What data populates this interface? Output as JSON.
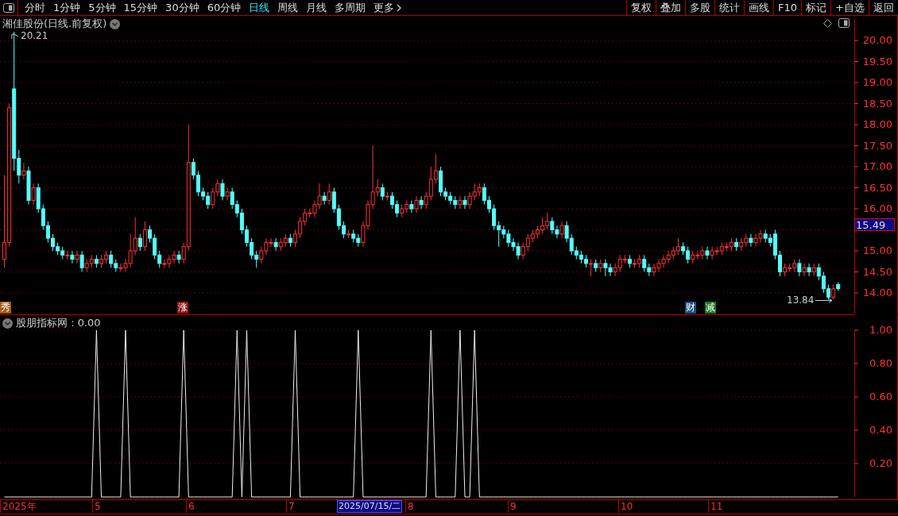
{
  "toolbar": {
    "periods": [
      {
        "label": "分时",
        "selected": false
      },
      {
        "label": "1分钟",
        "selected": false
      },
      {
        "label": "5分钟",
        "selected": false
      },
      {
        "label": "15分钟",
        "selected": false
      },
      {
        "label": "30分钟",
        "selected": false
      },
      {
        "label": "60分钟",
        "selected": false
      },
      {
        "label": "日线",
        "selected": true
      },
      {
        "label": "周线",
        "selected": false
      },
      {
        "label": "月线",
        "selected": false
      },
      {
        "label": "多周期",
        "selected": false
      },
      {
        "label": "更多",
        "selected": false
      }
    ],
    "actions": [
      "复权",
      "叠加",
      "多股",
      "统计",
      "画线",
      "F10",
      "标记",
      "+自选",
      "返回"
    ]
  },
  "price_panel": {
    "title": "湘佳股份(日线.前复权)",
    "high_label": "20.21",
    "low_label": "13.84",
    "current_price": "15.49",
    "chart_data": {
      "type": "candlestick",
      "ylim": [
        13.5,
        20.5
      ],
      "grid": true,
      "yticks": [
        {
          "value": 20,
          "label": "20.00"
        },
        {
          "value": 19.5,
          "label": "19.50"
        },
        {
          "value": 19,
          "label": "19.00"
        },
        {
          "value": 18.5,
          "label": "18.50"
        },
        {
          "value": 18,
          "label": "18.00"
        },
        {
          "value": 17.5,
          "label": "17.50"
        },
        {
          "value": 17,
          "label": "17.00"
        },
        {
          "value": 16.5,
          "label": "16.50"
        },
        {
          "value": 16,
          "label": "16.00"
        },
        {
          "value": 15,
          "label": "15.00"
        },
        {
          "value": 14.5,
          "label": "14.50"
        },
        {
          "value": 14,
          "label": "14.00"
        }
      ],
      "ohlc": [
        [
          14.8,
          16.8,
          14.6,
          15.2
        ],
        [
          15.2,
          18.5,
          15.1,
          18.4
        ],
        [
          18.85,
          20.21,
          16.9,
          17.2
        ],
        [
          17.2,
          17.4,
          16.6,
          16.8
        ],
        [
          16.8,
          17.1,
          16.7,
          16.9
        ],
        [
          16.9,
          17.0,
          16.1,
          16.2
        ],
        [
          16.2,
          16.6,
          16.1,
          16.5
        ],
        [
          16.5,
          16.6,
          15.9,
          16.0
        ],
        [
          16.0,
          16.1,
          15.5,
          15.6
        ],
        [
          15.6,
          15.7,
          15.2,
          15.3
        ],
        [
          15.3,
          15.4,
          15.0,
          15.1
        ],
        [
          15.1,
          15.2,
          14.9,
          15.0
        ],
        [
          15.0,
          15.1,
          14.8,
          14.9
        ],
        [
          14.9,
          15.0,
          14.8,
          14.9
        ],
        [
          14.9,
          15.0,
          14.7,
          14.8
        ],
        [
          14.8,
          15.0,
          14.7,
          14.9
        ],
        [
          14.9,
          15.0,
          14.5,
          14.6
        ],
        [
          14.6,
          14.8,
          14.5,
          14.7
        ],
        [
          14.7,
          14.9,
          14.6,
          14.8
        ],
        [
          14.8,
          14.9,
          14.6,
          14.7
        ],
        [
          14.7,
          14.9,
          14.6,
          14.8
        ],
        [
          14.8,
          15.0,
          14.7,
          14.9
        ],
        [
          14.9,
          15.0,
          14.6,
          14.7
        ],
        [
          14.7,
          14.8,
          14.5,
          14.6
        ],
        [
          14.6,
          14.7,
          14.5,
          14.6
        ],
        [
          14.6,
          14.8,
          14.5,
          14.7
        ],
        [
          14.7,
          15.4,
          14.6,
          15.0
        ],
        [
          15.0,
          15.8,
          14.9,
          15.3
        ],
        [
          15.3,
          15.4,
          15.0,
          15.1
        ],
        [
          15.1,
          15.7,
          15.0,
          15.5
        ],
        [
          15.5,
          15.6,
          15.2,
          15.3
        ],
        [
          15.3,
          15.4,
          14.8,
          14.9
        ],
        [
          14.9,
          15.0,
          14.6,
          14.7
        ],
        [
          14.7,
          14.8,
          14.6,
          14.7
        ],
        [
          14.7,
          14.9,
          14.6,
          14.8
        ],
        [
          14.8,
          15.0,
          14.7,
          14.9
        ],
        [
          14.9,
          15.0,
          14.7,
          14.8
        ],
        [
          14.8,
          15.2,
          14.7,
          15.1
        ],
        [
          15.1,
          18.0,
          15.0,
          17.1
        ],
        [
          17.1,
          17.2,
          16.7,
          16.8
        ],
        [
          16.8,
          16.9,
          16.3,
          16.4
        ],
        [
          16.4,
          16.5,
          16.2,
          16.3
        ],
        [
          16.3,
          16.4,
          16.0,
          16.1
        ],
        [
          16.1,
          16.5,
          16.0,
          16.4
        ],
        [
          16.4,
          16.7,
          16.3,
          16.6
        ],
        [
          16.6,
          16.7,
          16.2,
          16.3
        ],
        [
          16.3,
          16.5,
          16.2,
          16.4
        ],
        [
          16.4,
          16.5,
          16.0,
          16.1
        ],
        [
          16.1,
          16.2,
          15.8,
          15.9
        ],
        [
          15.9,
          16.0,
          15.4,
          15.5
        ],
        [
          15.5,
          15.6,
          15.1,
          15.2
        ],
        [
          15.2,
          15.3,
          14.8,
          14.9
        ],
        [
          14.9,
          15.0,
          14.6,
          14.8
        ],
        [
          14.8,
          15.1,
          14.7,
          15.0
        ],
        [
          15.0,
          15.3,
          14.9,
          15.2
        ],
        [
          15.2,
          15.3,
          15.1,
          15.2
        ],
        [
          15.2,
          15.3,
          15.0,
          15.1
        ],
        [
          15.1,
          15.3,
          15.0,
          15.2
        ],
        [
          15.2,
          15.4,
          15.1,
          15.3
        ],
        [
          15.3,
          15.4,
          15.1,
          15.2
        ],
        [
          15.2,
          15.5,
          15.1,
          15.4
        ],
        [
          15.4,
          15.8,
          15.3,
          15.7
        ],
        [
          15.7,
          16.0,
          15.6,
          15.9
        ],
        [
          15.9,
          16.0,
          15.8,
          15.9
        ],
        [
          15.9,
          16.2,
          15.8,
          16.1
        ],
        [
          16.1,
          16.6,
          16.0,
          16.3
        ],
        [
          16.3,
          16.4,
          16.1,
          16.2
        ],
        [
          16.2,
          16.6,
          16.1,
          16.4
        ],
        [
          16.4,
          16.5,
          15.9,
          16.0
        ],
        [
          16.0,
          16.1,
          15.5,
          15.6
        ],
        [
          15.6,
          15.7,
          15.3,
          15.4
        ],
        [
          15.4,
          15.5,
          15.3,
          15.4
        ],
        [
          15.4,
          15.5,
          15.2,
          15.3
        ],
        [
          15.3,
          15.4,
          15.1,
          15.2
        ],
        [
          15.2,
          15.7,
          15.1,
          15.6
        ],
        [
          15.6,
          16.2,
          15.5,
          16.1
        ],
        [
          16.1,
          17.5,
          16.0,
          16.4
        ],
        [
          16.4,
          16.7,
          16.3,
          16.5
        ],
        [
          16.5,
          16.6,
          16.2,
          16.3
        ],
        [
          16.3,
          16.4,
          16.2,
          16.3
        ],
        [
          16.3,
          16.4,
          16.0,
          16.1
        ],
        [
          16.1,
          16.2,
          15.8,
          15.9
        ],
        [
          15.9,
          16.1,
          15.8,
          16.0
        ],
        [
          16.0,
          16.2,
          15.9,
          16.1
        ],
        [
          16.1,
          16.2,
          15.9,
          16.0
        ],
        [
          16.0,
          16.3,
          15.9,
          16.2
        ],
        [
          16.2,
          16.3,
          16.0,
          16.1
        ],
        [
          16.1,
          16.4,
          16.0,
          16.3
        ],
        [
          16.3,
          17.0,
          16.2,
          16.7
        ],
        [
          16.7,
          17.3,
          16.6,
          16.9
        ],
        [
          16.9,
          17.0,
          16.3,
          16.4
        ],
        [
          16.4,
          16.5,
          16.2,
          16.3
        ],
        [
          16.3,
          16.4,
          16.1,
          16.2
        ],
        [
          16.2,
          16.3,
          16.0,
          16.1
        ],
        [
          16.1,
          16.3,
          16.0,
          16.2
        ],
        [
          16.2,
          16.3,
          16.0,
          16.1
        ],
        [
          16.1,
          16.4,
          16.0,
          16.3
        ],
        [
          16.3,
          16.6,
          16.2,
          16.4
        ],
        [
          16.4,
          16.6,
          16.3,
          16.5
        ],
        [
          16.5,
          16.6,
          16.1,
          16.2
        ],
        [
          16.2,
          16.3,
          15.9,
          16.0
        ],
        [
          16.0,
          16.1,
          15.5,
          15.6
        ],
        [
          15.6,
          15.7,
          15.1,
          15.5
        ],
        [
          15.5,
          15.6,
          15.3,
          15.4
        ],
        [
          15.4,
          15.5,
          15.1,
          15.2
        ],
        [
          15.2,
          15.3,
          15.0,
          15.1
        ],
        [
          15.1,
          15.2,
          14.8,
          14.9
        ],
        [
          14.9,
          15.2,
          14.8,
          15.1
        ],
        [
          15.1,
          15.4,
          15.0,
          15.3
        ],
        [
          15.3,
          15.5,
          15.2,
          15.4
        ],
        [
          15.4,
          15.6,
          15.3,
          15.5
        ],
        [
          15.5,
          15.8,
          15.4,
          15.6
        ],
        [
          15.6,
          15.9,
          15.5,
          15.7
        ],
        [
          15.7,
          15.8,
          15.4,
          15.5
        ],
        [
          15.5,
          15.6,
          15.3,
          15.4
        ],
        [
          15.4,
          15.7,
          15.3,
          15.6
        ],
        [
          15.6,
          15.7,
          15.2,
          15.3
        ],
        [
          15.3,
          15.4,
          14.9,
          15.0
        ],
        [
          15.0,
          15.1,
          14.8,
          14.9
        ],
        [
          14.9,
          15.0,
          14.7,
          14.8
        ],
        [
          14.8,
          14.9,
          14.6,
          14.7
        ],
        [
          14.7,
          14.8,
          14.4,
          14.7
        ],
        [
          14.7,
          14.8,
          14.5,
          14.6
        ],
        [
          14.6,
          14.8,
          14.5,
          14.7
        ],
        [
          14.7,
          14.8,
          14.4,
          14.6
        ],
        [
          14.6,
          14.7,
          14.4,
          14.5
        ],
        [
          14.5,
          14.7,
          14.4,
          14.6
        ],
        [
          14.6,
          14.9,
          14.5,
          14.8
        ],
        [
          14.8,
          14.9,
          14.7,
          14.8
        ],
        [
          14.8,
          14.9,
          14.6,
          14.7
        ],
        [
          14.7,
          14.8,
          14.6,
          14.7
        ],
        [
          14.7,
          14.9,
          14.6,
          14.8
        ],
        [
          14.8,
          14.9,
          14.5,
          14.6
        ],
        [
          14.6,
          14.7,
          14.4,
          14.5
        ],
        [
          14.5,
          14.7,
          14.4,
          14.6
        ],
        [
          14.6,
          14.8,
          14.5,
          14.7
        ],
        [
          14.7,
          14.9,
          14.6,
          14.8
        ],
        [
          14.8,
          15.0,
          14.7,
          14.9
        ],
        [
          14.9,
          15.1,
          14.8,
          15.0
        ],
        [
          15.0,
          15.3,
          14.9,
          15.1
        ],
        [
          15.1,
          15.2,
          14.9,
          15.0
        ],
        [
          15.0,
          15.1,
          14.7,
          14.8
        ],
        [
          14.8,
          15.0,
          14.7,
          14.9
        ],
        [
          14.9,
          15.0,
          14.8,
          14.9
        ],
        [
          14.9,
          15.1,
          14.8,
          15.0
        ],
        [
          15.0,
          15.1,
          14.8,
          14.9
        ],
        [
          14.9,
          15.1,
          14.8,
          15.0
        ],
        [
          15.0,
          15.1,
          14.9,
          15.0
        ],
        [
          15.0,
          15.2,
          14.9,
          15.1
        ],
        [
          15.1,
          15.2,
          15.0,
          15.1
        ],
        [
          15.1,
          15.3,
          15.0,
          15.2
        ],
        [
          15.2,
          15.3,
          15.0,
          15.1
        ],
        [
          15.1,
          15.3,
          15.0,
          15.2
        ],
        [
          15.2,
          15.4,
          15.1,
          15.3
        ],
        [
          15.3,
          15.4,
          15.1,
          15.2
        ],
        [
          15.2,
          15.4,
          15.1,
          15.3
        ],
        [
          15.3,
          15.5,
          15.2,
          15.4
        ],
        [
          15.4,
          15.5,
          15.2,
          15.3
        ],
        [
          15.3,
          15.4,
          15.1,
          15.2
        ],
        [
          15.4,
          15.5,
          14.8,
          14.9
        ],
        [
          14.9,
          15.0,
          14.4,
          14.5
        ],
        [
          14.5,
          14.7,
          14.4,
          14.6
        ],
        [
          14.6,
          14.7,
          14.5,
          14.6
        ],
        [
          14.6,
          14.8,
          14.5,
          14.7
        ],
        [
          14.7,
          14.8,
          14.4,
          14.5
        ],
        [
          14.5,
          14.7,
          14.4,
          14.6
        ],
        [
          14.6,
          14.7,
          14.4,
          14.5
        ],
        [
          14.5,
          14.7,
          14.4,
          14.6
        ],
        [
          14.6,
          14.7,
          14.3,
          14.4
        ],
        [
          14.4,
          14.5,
          14.0,
          14.1
        ],
        [
          14.1,
          14.2,
          13.84,
          13.9
        ],
        [
          13.9,
          14.2,
          13.85,
          14.1
        ],
        [
          14.2,
          14.25,
          14.05,
          14.1
        ]
      ]
    },
    "markers": [
      {
        "text": "秀",
        "color": "#a85a12"
      },
      {
        "text": "涨",
        "color": "#8c1010"
      },
      {
        "text": "财",
        "color": "#184e86"
      },
      {
        "text": "减",
        "color": "#1e7a22"
      }
    ]
  },
  "indicator_panel": {
    "title": "股朋指标网 : 0.00",
    "chart_data": {
      "type": "line",
      "ylim": [
        0,
        1
      ],
      "grid": true,
      "yticks": [
        {
          "value": 1,
          "label": "1.00"
        },
        {
          "value": 0.8,
          "label": "0.80"
        },
        {
          "value": 0.6,
          "label": "0.60"
        },
        {
          "value": 0.4,
          "label": "0.40"
        },
        {
          "value": 0.2,
          "label": "0.20"
        }
      ],
      "series": [
        {
          "color": "#eeeeee",
          "values": [
            0,
            0,
            0,
            0,
            0,
            0,
            0,
            0,
            0,
            0,
            0,
            0,
            0,
            0,
            0,
            0,
            0,
            0,
            0,
            1,
            0,
            0,
            0,
            0,
            0,
            1,
            0,
            0,
            0,
            0,
            0,
            0,
            0,
            0,
            0,
            0,
            0,
            1,
            0,
            0,
            0,
            0,
            0,
            0,
            0,
            0,
            0,
            0,
            1,
            0,
            1,
            0,
            0,
            0,
            0,
            0,
            0,
            0,
            0,
            0,
            1,
            0,
            0,
            0,
            0,
            0,
            0,
            0,
            0,
            0,
            0,
            0,
            0,
            1,
            0,
            0,
            0,
            0,
            0,
            0,
            0,
            0,
            0,
            0,
            0,
            0,
            0,
            0,
            1,
            0,
            0,
            0,
            0,
            0,
            1,
            0,
            0,
            1,
            0,
            0,
            0,
            0,
            0,
            0,
            0,
            0,
            0,
            0,
            0,
            0,
            0,
            0,
            0,
            0,
            0,
            0,
            0,
            0,
            0,
            0,
            0,
            0,
            0,
            0,
            0,
            0,
            0,
            0,
            0,
            0,
            0,
            0,
            0,
            0,
            0,
            0,
            0,
            0,
            0,
            0,
            0,
            0,
            0,
            0,
            0,
            0,
            0,
            0,
            0,
            0,
            0,
            0,
            0,
            0,
            0,
            0,
            0,
            0,
            0,
            0,
            0,
            0,
            0,
            0,
            0,
            0,
            0,
            0,
            0,
            0,
            0,
            0,
            0
          ]
        }
      ]
    }
  },
  "date_axis": [
    {
      "label": "2025年",
      "selected": false
    },
    {
      "label": "5",
      "selected": false
    },
    {
      "label": "6",
      "selected": false
    },
    {
      "label": "7",
      "selected": false
    },
    {
      "label": "2025/07/15/二",
      "selected": true
    },
    {
      "label": "8",
      "selected": false
    },
    {
      "label": "9",
      "selected": false
    },
    {
      "label": "10",
      "selected": false
    },
    {
      "label": "11",
      "selected": false
    }
  ]
}
